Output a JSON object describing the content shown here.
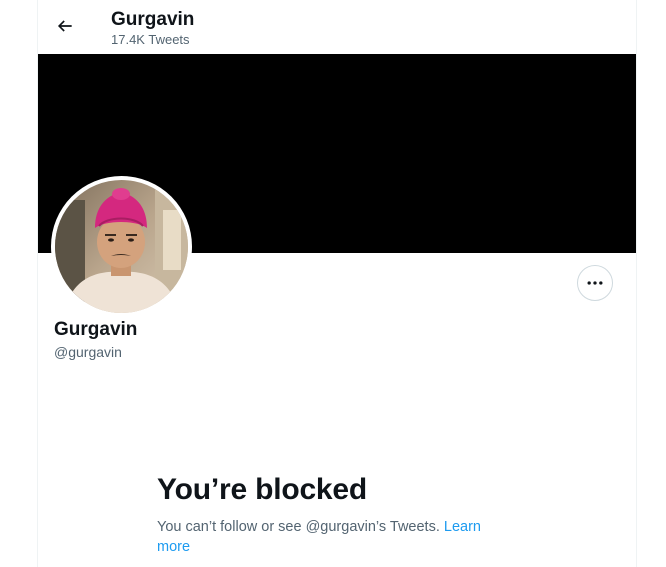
{
  "header": {
    "name": "Gurgavin",
    "tweet_count": "17.4K Tweets"
  },
  "profile": {
    "name": "Gurgavin",
    "handle": "@gurgavin"
  },
  "blocked": {
    "title": "You’re blocked",
    "message": "You can’t follow or see @gurgavin’s Tweets.",
    "learn_more": "Learn more"
  },
  "colors": {
    "accent": "#1d9bf0",
    "banner": "#000000",
    "secondary_text": "#536471",
    "turban": "#d4287f"
  },
  "icons": {
    "back": "arrow-left-icon",
    "more": "more-horizontal-icon"
  }
}
